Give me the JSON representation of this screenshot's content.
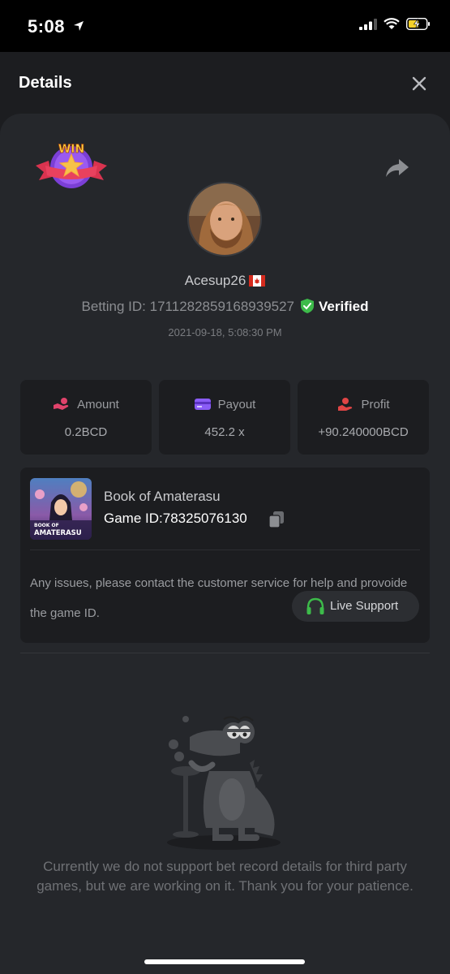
{
  "status_bar": {
    "time": "5:08"
  },
  "header": {
    "title": "Details"
  },
  "badge": {
    "text": "WIN"
  },
  "player": {
    "username": "Acesup26",
    "betting_id_label": "Betting ID:",
    "betting_id": "1711282859168939527",
    "verified_label": "Verified",
    "timestamp": "2021-09-18, 5:08:30 PM"
  },
  "stats": [
    {
      "label": "Amount",
      "value": "0.2BCD",
      "icon": "amount-icon",
      "color": "#e0436b"
    },
    {
      "label": "Payout",
      "value": "452.2 x",
      "icon": "payout-icon",
      "color": "#8a5cf6"
    },
    {
      "label": "Profit",
      "value": "+90.240000BCD",
      "icon": "profit-icon",
      "color": "#e04545"
    }
  ],
  "game": {
    "name": "Book of Amaterasu",
    "id_label": "Game ID:",
    "id_value": "78325076130",
    "thumb_line1": "BOOK OF",
    "thumb_line2": "AMATERASU",
    "issue_text": "Any issues, please contact the customer service for help and provoide the game ID.",
    "support_label": "Live Support"
  },
  "empty_state": {
    "message": "Currently we do not support bet record details for third party games, but we are working on it. Thank you for your patience."
  },
  "colors": {
    "verified": "#3dbb4a",
    "support": "#3dbb4a",
    "card": "#25272b",
    "box": "#1c1d20"
  }
}
